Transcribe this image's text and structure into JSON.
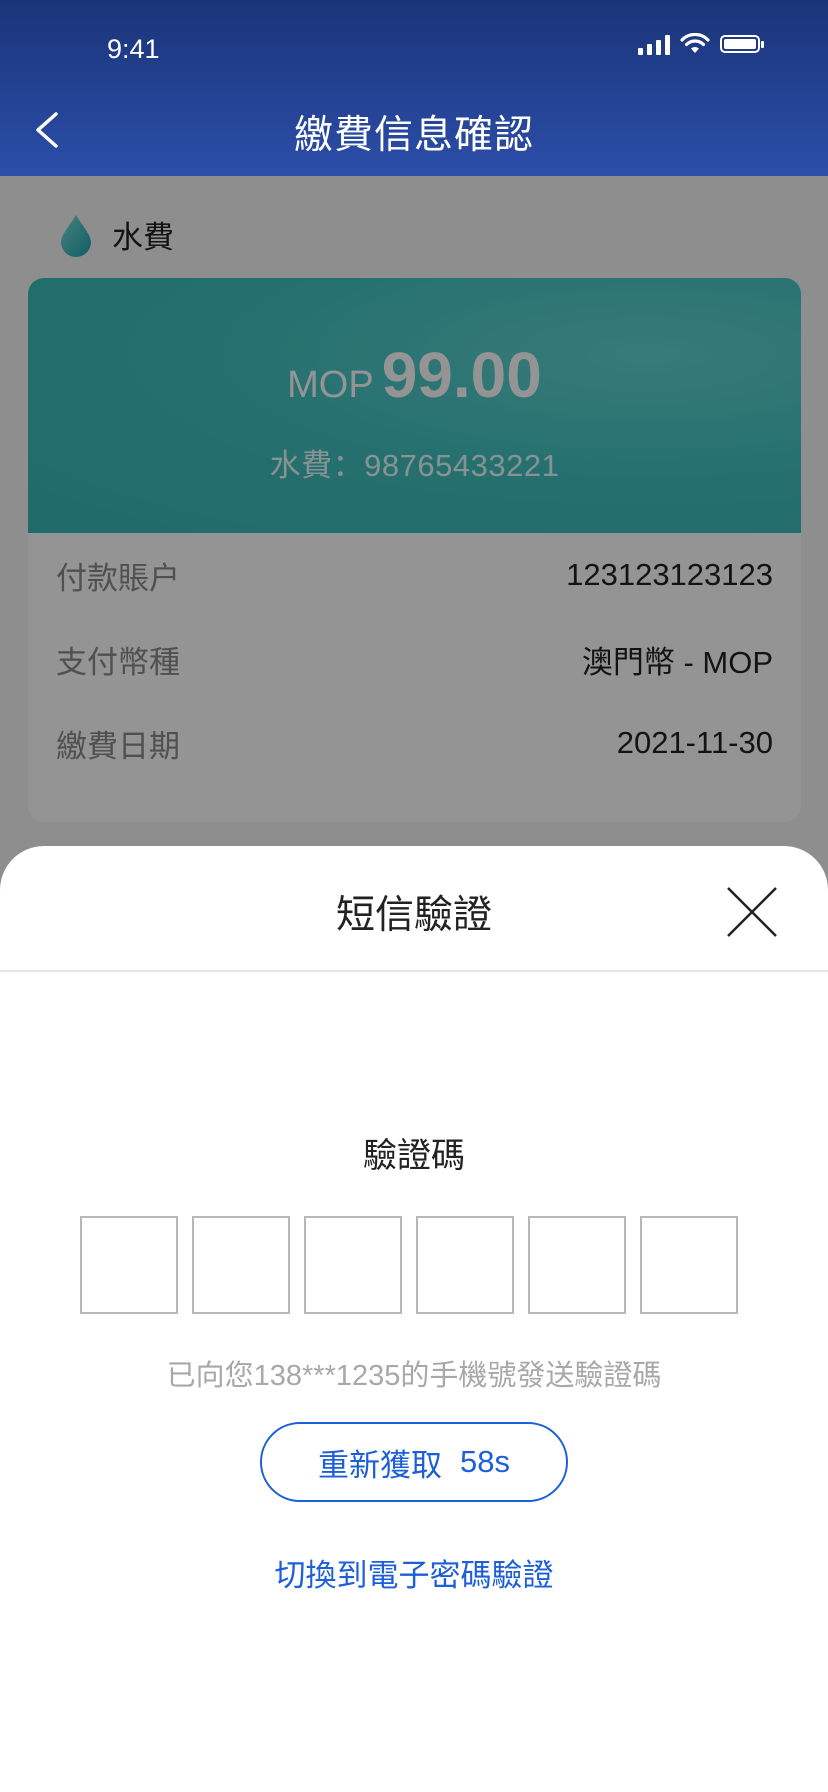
{
  "status_bar": {
    "time": "9:41"
  },
  "nav": {
    "title": "繳費信息確認"
  },
  "fee": {
    "type_label": "水費",
    "currency": "MOP",
    "amount": "99.00",
    "account_line": "水費：98765433221"
  },
  "details": [
    {
      "label": "付款賬户",
      "value": "123123123123"
    },
    {
      "label": "支付幣種",
      "value": "澳門幣 - MOP"
    },
    {
      "label": "繳費日期",
      "value": "2021-11-30"
    }
  ],
  "sheet": {
    "title": "短信驗證",
    "code_label": "驗證碼",
    "hint": "已向您138***1235的手機號發送驗證碼",
    "resend_label": "重新獲取",
    "resend_countdown": "58s",
    "switch_label": "切換到電子密碼驗證"
  },
  "colors": {
    "header": "#1a3479",
    "card_accent": "#42c3c1",
    "link": "#1c5fd9"
  },
  "icons": [
    "back-icon",
    "water-drop-icon",
    "close-icon",
    "signal-icon",
    "wifi-icon",
    "battery-icon"
  ]
}
